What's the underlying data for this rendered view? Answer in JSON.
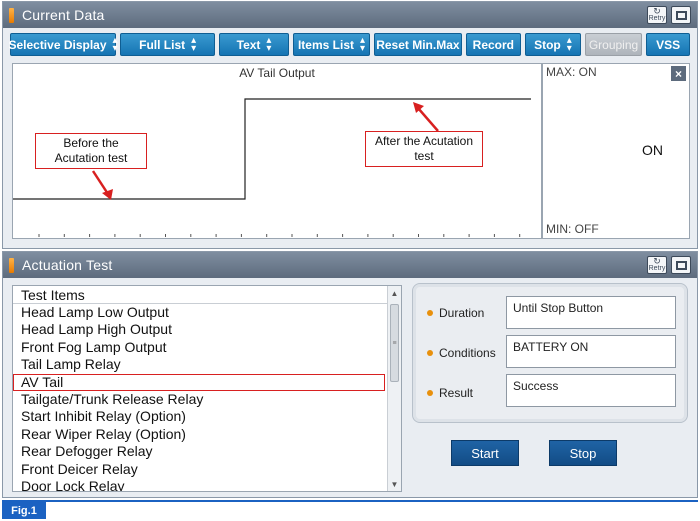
{
  "current_window": {
    "title": "Current Data",
    "retry_label": "Retry"
  },
  "toolbar": [
    {
      "label": "Selective Display",
      "arrows": true
    },
    {
      "label": "Full List",
      "arrows": true
    },
    {
      "label": "Text",
      "arrows": true
    },
    {
      "label": "Items List",
      "arrows": true
    },
    {
      "label": "Reset Min.Max",
      "arrows": false
    },
    {
      "label": "Record",
      "arrows": false
    },
    {
      "label": "Stop",
      "arrows": true
    },
    {
      "label": "Grouping",
      "arrows": false,
      "disabled": true
    },
    {
      "label": "VSS",
      "arrows": false
    }
  ],
  "graph": {
    "title": "AV Tail Output",
    "callout_before": "Before the Acutation test",
    "callout_after": "After the Acutation test"
  },
  "side": {
    "max": "MAX: ON",
    "min": "MIN: OFF",
    "value": "ON",
    "close": "×"
  },
  "actuation_window": {
    "title": "Actuation Test",
    "retry_label": "Retry"
  },
  "list": {
    "header": "Test Items",
    "items": [
      "Head Lamp Low Output",
      "Head Lamp High Output",
      "Front Fog Lamp Output",
      "Tail Lamp Relay",
      "AV Tail",
      "Tailgate/Trunk Release Relay",
      "Start Inhibit Relay (Option)",
      "Rear Wiper Relay (Option)",
      "Rear Defogger Relay",
      "Front Deicer Relay",
      "Door Lock Relay"
    ],
    "selected_index": 4
  },
  "details": {
    "duration_label": "Duration",
    "duration_value": "Until Stop Button",
    "conditions_label": "Conditions",
    "conditions_value": "BATTERY ON",
    "result_label": "Result",
    "result_value": "Success"
  },
  "buttons": {
    "start": "Start",
    "stop": "Stop"
  },
  "figure_label": "Fig.1",
  "colors": {
    "accent_blue": "#1574b3",
    "highlight_red": "#d82020",
    "title_bar": "#5d6b7d",
    "bullet_orange": "#e8900c"
  }
}
